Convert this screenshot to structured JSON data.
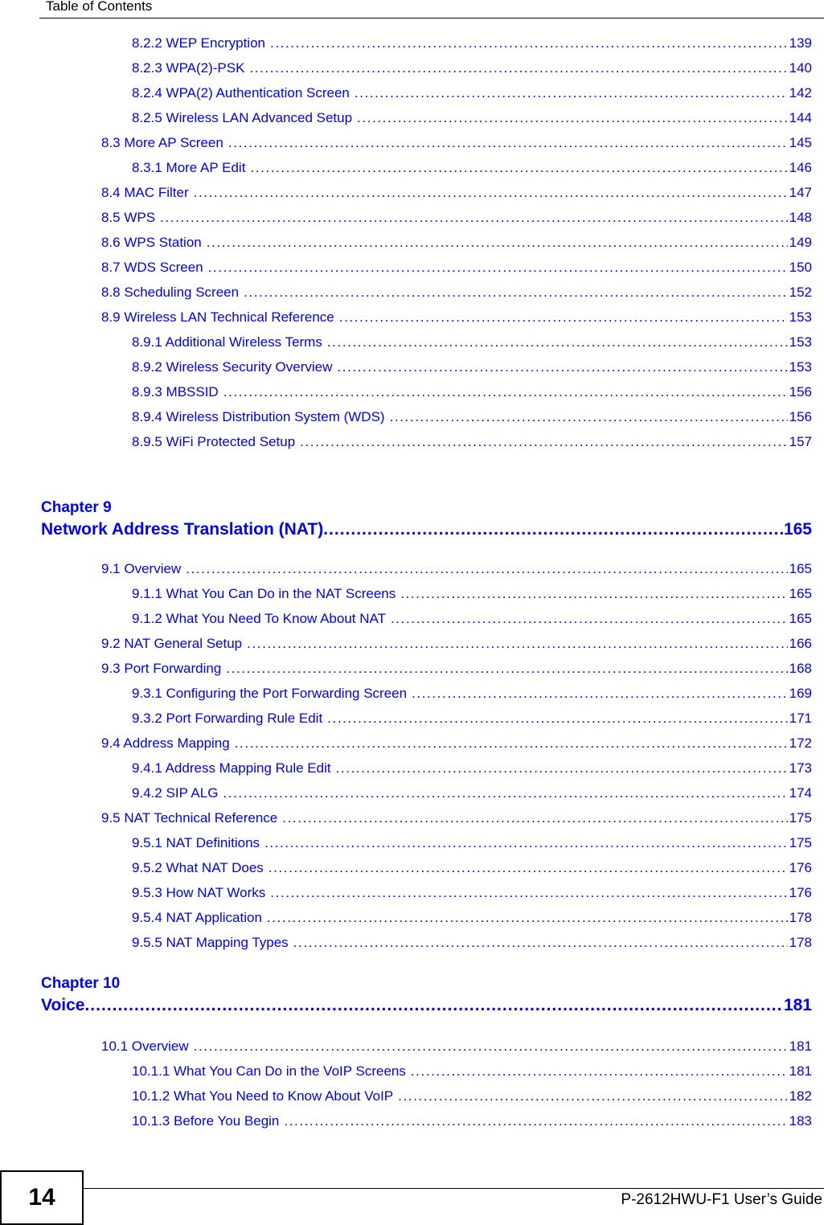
{
  "header": {
    "title": "Table of Contents"
  },
  "toc": [
    {
      "level": 2,
      "label": "8.2.2 WEP Encryption",
      "page": "139"
    },
    {
      "level": 2,
      "label": "8.2.3 WPA(2)-PSK",
      "page": "140"
    },
    {
      "level": 2,
      "label": "8.2.4 WPA(2) Authentication Screen",
      "page": "142"
    },
    {
      "level": 2,
      "label": "8.2.5 Wireless LAN Advanced Setup",
      "page": "144"
    },
    {
      "level": 1,
      "label": "8.3 More AP Screen",
      "page": "145"
    },
    {
      "level": 2,
      "label": "8.3.1 More AP Edit",
      "page": "146"
    },
    {
      "level": 1,
      "label": "8.4 MAC Filter",
      "page": "147"
    },
    {
      "level": 1,
      "label": "8.5 WPS",
      "page": "148"
    },
    {
      "level": 1,
      "label": "8.6 WPS Station",
      "page": "149"
    },
    {
      "level": 1,
      "label": "8.7 WDS Screen",
      "page": "150"
    },
    {
      "level": 1,
      "label": "8.8 Scheduling Screen",
      "page": "152"
    },
    {
      "level": 1,
      "label": "8.9 Wireless LAN Technical Reference",
      "page": "153"
    },
    {
      "level": 2,
      "label": "8.9.1 Additional Wireless Terms",
      "page": "153"
    },
    {
      "level": 2,
      "label": "8.9.2 Wireless Security Overview",
      "page": "153"
    },
    {
      "level": 2,
      "label": "8.9.3 MBSSID",
      "page": "156"
    },
    {
      "level": 2,
      "label": "8.9.4 Wireless Distribution System (WDS)",
      "page": "156"
    },
    {
      "level": 2,
      "label": "8.9.5 WiFi Protected Setup",
      "page": "157"
    }
  ],
  "chapter9": {
    "number": "Chapter  9",
    "title": "Network Address Translation (NAT)",
    "page": "165",
    "entries": [
      {
        "level": 1,
        "label": "9.1 Overview",
        "page": "165"
      },
      {
        "level": 2,
        "label": "9.1.1 What You Can Do in the NAT Screens",
        "page": "165"
      },
      {
        "level": 2,
        "label": "9.1.2 What You Need To Know About NAT",
        "page": "165"
      },
      {
        "level": 1,
        "label": "9.2 NAT General Setup",
        "page": "166"
      },
      {
        "level": 1,
        "label": "9.3 Port Forwarding",
        "page": "168"
      },
      {
        "level": 2,
        "label": "9.3.1 Configuring the Port Forwarding Screen",
        "page": "169"
      },
      {
        "level": 2,
        "label": "9.3.2 Port Forwarding Rule Edit",
        "page": "171"
      },
      {
        "level": 1,
        "label": "9.4 Address Mapping",
        "page": "172"
      },
      {
        "level": 2,
        "label": "9.4.1 Address Mapping Rule Edit",
        "page": "173"
      },
      {
        "level": 2,
        "label": "9.4.2 SIP ALG",
        "page": "174"
      },
      {
        "level": 1,
        "label": "9.5 NAT Technical Reference",
        "page": "175"
      },
      {
        "level": 2,
        "label": "9.5.1 NAT Definitions",
        "page": "175"
      },
      {
        "level": 2,
        "label": "9.5.2 What NAT Does",
        "page": "176"
      },
      {
        "level": 2,
        "label": "9.5.3 How NAT Works",
        "page": "176"
      },
      {
        "level": 2,
        "label": "9.5.4 NAT Application",
        "page": "178"
      },
      {
        "level": 2,
        "label": "9.5.5 NAT Mapping Types",
        "page": "178"
      }
    ]
  },
  "chapter10": {
    "number": "Chapter  10",
    "title": "Voice",
    "page": "181",
    "entries": [
      {
        "level": 1,
        "label": "10.1 Overview",
        "page": "181"
      },
      {
        "level": 2,
        "label": "10.1.1 What You Can Do in the VoIP Screens",
        "page": "181"
      },
      {
        "level": 2,
        "label": "10.1.2 What You Need to Know About VoIP",
        "page": "182"
      },
      {
        "level": 2,
        "label": "10.1.3 Before You Begin",
        "page": "183"
      }
    ]
  },
  "footer": {
    "page_number": "14",
    "guide_title": "P-2612HWU-F1 User’s Guide"
  }
}
